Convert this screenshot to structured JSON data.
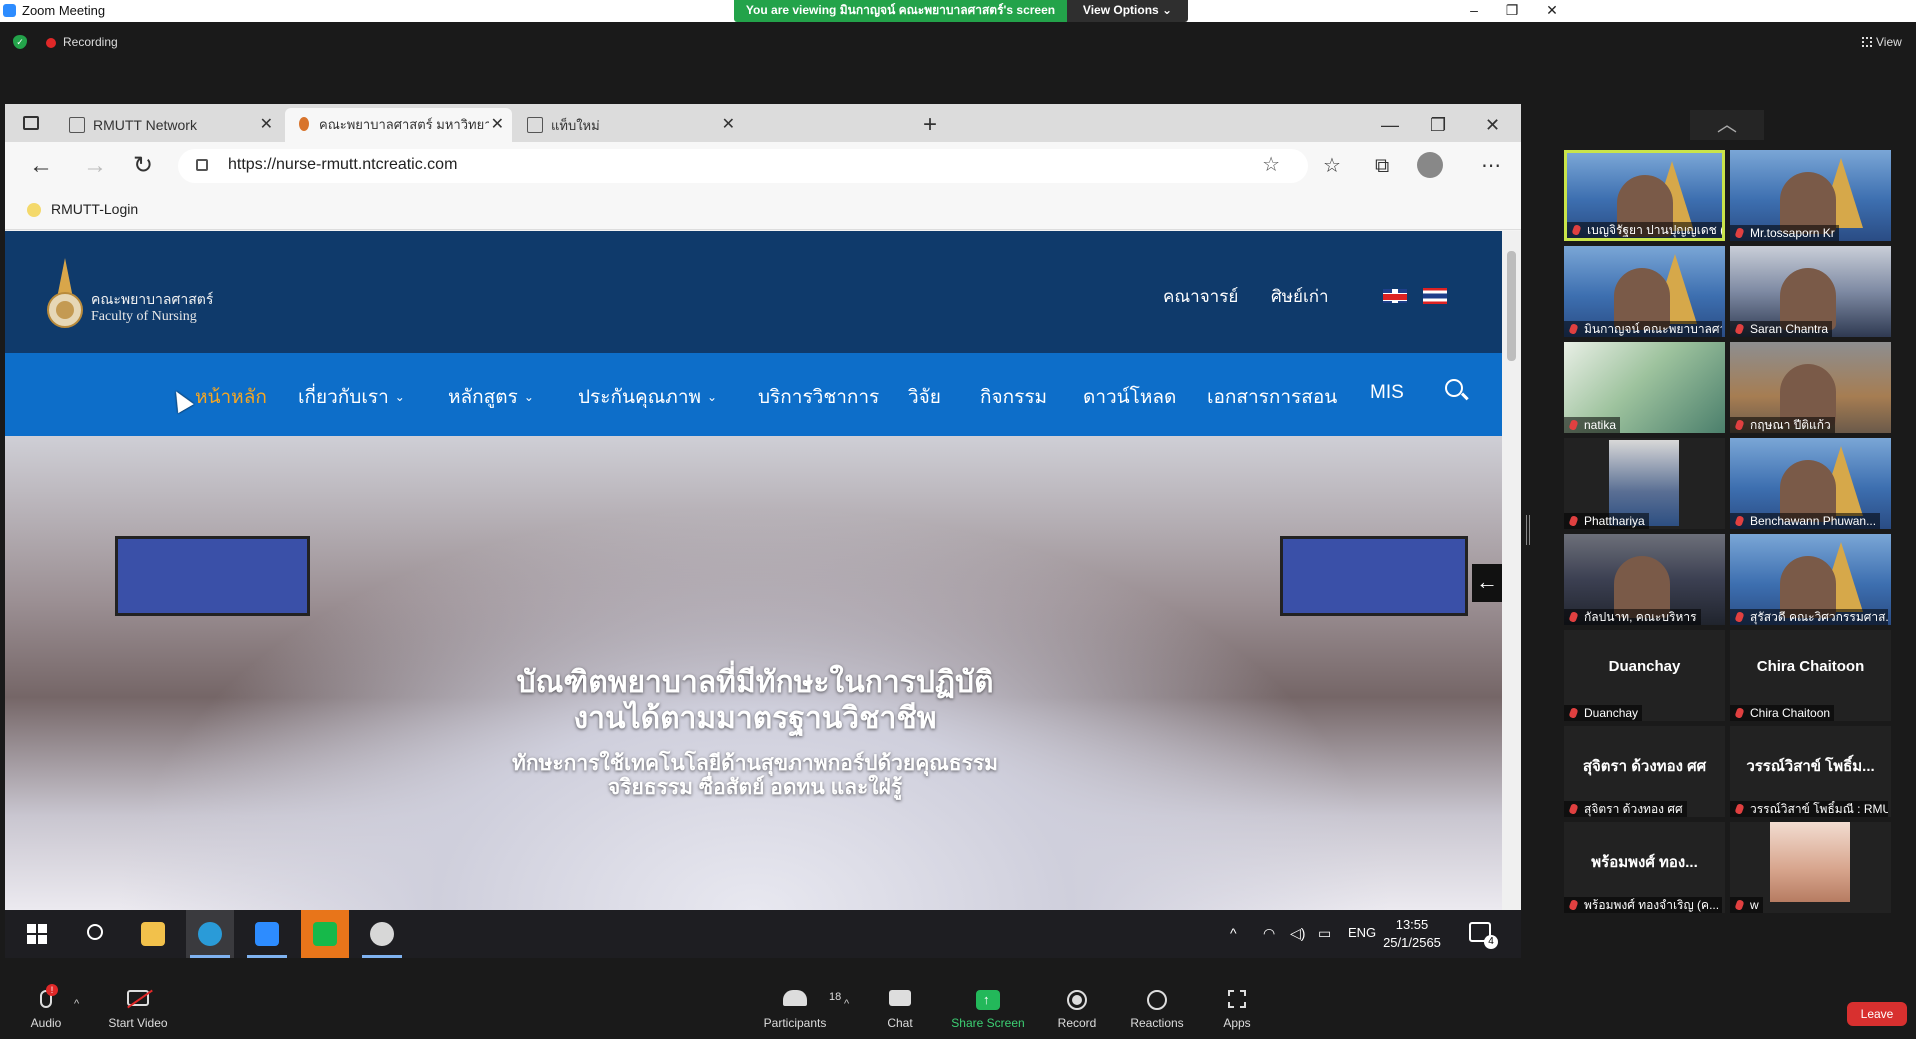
{
  "zoom": {
    "title": "Zoom Meeting",
    "viewing_banner": "You are viewing มินกาญจน์ คณะพยาบาลศาสตร์'s screen",
    "view_options": "View Options ⌄",
    "recording": "Recording",
    "view_label": "View",
    "minimize": "–",
    "maximize": "❐",
    "close": "✕"
  },
  "browser": {
    "tabs": [
      {
        "label": "RMUTT Network Authentication",
        "active": false
      },
      {
        "label": "คณะพยาบาลศาสตร์ มหาวิทยาลัยเทคโ",
        "active": true
      },
      {
        "label": "แท็บใหม่",
        "active": false
      }
    ],
    "tab_close": "✕",
    "new_tab": "+",
    "url": "https://nurse-rmutt.ntcreatic.com",
    "favorites": [
      "RMUTT-Login"
    ],
    "win_min": "—",
    "win_max": "❐",
    "win_close": "✕",
    "back": "←",
    "forward": "→",
    "reload": "↻",
    "star": "☆",
    "fav_icon": "☆",
    "collections": "⧉",
    "more": "⋯"
  },
  "site": {
    "logo_th": "คณะพยาบาลศาสตร์",
    "logo_en": "Faculty of Nursing",
    "top_links": [
      "คณาจารย์",
      "ศิษย์เก่า"
    ],
    "nav": [
      {
        "label": "หน้าหลัก",
        "caret": false,
        "active": true
      },
      {
        "label": "เกี่ยวกับเรา",
        "caret": true,
        "active": false
      },
      {
        "label": "หลักสูตร",
        "caret": true,
        "active": false
      },
      {
        "label": "ประกันคุณภาพ",
        "caret": true,
        "active": false
      },
      {
        "label": "บริการวิชาการ",
        "caret": false,
        "active": false
      },
      {
        "label": "วิจัย",
        "caret": false,
        "active": false
      },
      {
        "label": "กิจกรรม",
        "caret": false,
        "active": false
      },
      {
        "label": "ดาวน์โหลด",
        "caret": false,
        "active": false
      },
      {
        "label": "เอกสารการสอน",
        "caret": false,
        "active": false
      },
      {
        "label": "MIS",
        "caret": false,
        "active": false
      }
    ],
    "caret": "⌄",
    "hero_title_1": "บัณฑิตพยาบาลที่มีทักษะในการปฏิบัติ",
    "hero_title_2": "งานได้ตามมาตรฐานวิชาชีพ",
    "hero_sub_1": "ทักษะการใช้เทคโนโลยีด้านสุขภาพกอร์ปด้วยคุณธรรม",
    "hero_sub_2": "จริยธรรม ซื่อสัตย์ อดทน และใฝ่รู้",
    "hero_arrow": "←"
  },
  "taskbar": {
    "tray_caret": "^",
    "lang": "ENG",
    "time": "13:55",
    "date": "25/1/2565",
    "notifications": "4"
  },
  "gallery": {
    "scroll_up": "︿",
    "tiles": [
      {
        "name": "เบญจิรัฐยา ปานปุญญเดช (สา...",
        "kind": "video"
      },
      {
        "name": "Mr.tossaporn Kr",
        "kind": "video"
      },
      {
        "name": "มินกาญจน์ คณะพยาบาลศาส...",
        "kind": "video"
      },
      {
        "name": "Saran Chantra",
        "kind": "office"
      },
      {
        "name": "natika",
        "kind": "poster"
      },
      {
        "name": "กฤษณา ปีติแก้ว",
        "kind": "room"
      },
      {
        "name": "Phatthariya",
        "kind": "cam"
      },
      {
        "name": "Benchawann Phuwan...",
        "kind": "video"
      },
      {
        "name": "กัลปนาท, คณะบริหาร",
        "kind": "office2"
      },
      {
        "name": "สุรัสวดี คณะวิศวกรรมศาส...",
        "kind": "video"
      },
      {
        "name": "Duanchay",
        "kind": "name",
        "display": "Duanchay"
      },
      {
        "name": "Chira Chaitoon",
        "kind": "name",
        "display": "Chira Chaitoon"
      },
      {
        "name": "สุจิตรา ด้วงทอง ศศ",
        "kind": "name",
        "display": "สุจิตรา ด้วงทอง ศศ"
      },
      {
        "name": "วรรณ์วิสาข์ โพธิ์มณี : RMU...",
        "kind": "name",
        "display": "วรรณ์วิสาข์ โพธิ์ม..."
      },
      {
        "name": "พร้อมพงศ์ ทองจำเริญ (ค...",
        "kind": "name",
        "display": "พร้อมพงศ์  ทอง..."
      },
      {
        "name": "w",
        "kind": "photo"
      }
    ]
  },
  "toolbar": {
    "audio": "Audio",
    "audio_badge": "!",
    "start_video": "Start Video",
    "participants": "Participants",
    "participants_count": "18",
    "chat": "Chat",
    "share_screen": "Share Screen",
    "share_arrow": "↑",
    "record": "Record",
    "reactions": "Reactions",
    "apps": "Apps",
    "leave": "Leave",
    "caret": "^"
  }
}
